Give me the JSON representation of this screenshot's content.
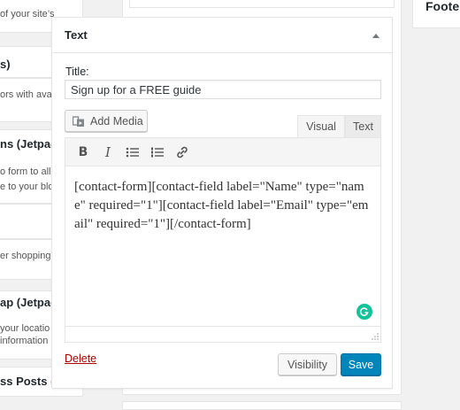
{
  "available_widgets": [
    {
      "title": "",
      "desc": "of your site’s"
    },
    {
      "title": "s)",
      "desc": ""
    },
    {
      "title": "",
      "desc": "ors with avat"
    },
    {
      "title": "ns (Jetpac",
      "desc": "o form to all"
    },
    {
      "title": "",
      "desc": "e to your blo"
    },
    {
      "title": "",
      "desc": "er shopping"
    },
    {
      "title": "ap (Jetpac",
      "desc": "your locatio"
    },
    {
      "title": "",
      "desc": "information"
    },
    {
      "title": "ss Posts (J",
      "desc": ""
    }
  ],
  "footer_sidebar": {
    "title": "Foote"
  },
  "widget": {
    "title": "Text",
    "title_label": "Title:",
    "title_value": "Sign up for a FREE guide",
    "add_media_label": "Add Media",
    "tabs": {
      "visual": "Visual",
      "text": "Text"
    },
    "content": "[contact-form][contact-field label=\"Name\" type=\"name\" required=\"1\"][contact-field label=\"Email\" type=\"email\" required=\"1\"][/contact-form]",
    "delete_label": "Delete",
    "visibility_label": "Visibility",
    "save_label": "Save"
  },
  "colors": {
    "save_button": "#0085ba",
    "delete_link": "#a00",
    "grammarly": "#15c39a"
  }
}
